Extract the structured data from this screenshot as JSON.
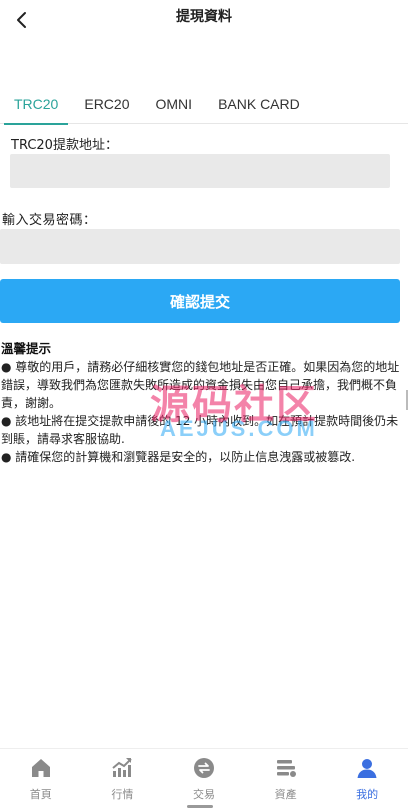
{
  "header": {
    "title": "提現資料",
    "back_icon": "chevron-left-icon"
  },
  "tabs": [
    {
      "label": "TRC20",
      "active": true
    },
    {
      "label": "ERC20",
      "active": false
    },
    {
      "label": "OMNI",
      "active": false
    },
    {
      "label": "BANK CARD",
      "active": false
    }
  ],
  "form": {
    "address_label": "TRC20提款地址：",
    "address_value": "",
    "password_label": "輸入交易密碼：",
    "password_value": "",
    "confirm_label": "確認提交"
  },
  "tips": {
    "title": "溫馨提示",
    "items": [
      "● 尊敬的用戶，請務必仔細核實您的錢包地址是否正確。如果因為您的地址錯誤，導致我們為您匯款失敗所造成的資金損失由您自己承擔，我們概不負責，謝謝。",
      "● 該地址將在提交提款申請後的 12 小時內收到。如在預計提款時間後仍未到賬，請尋求客服協助.",
      "● 請確保您的計算機和瀏覽器是安全的，以防止信息洩露或被篡改."
    ]
  },
  "watermark": {
    "main": "源码社区",
    "sub": "AEJUS.COM"
  },
  "nav": [
    {
      "label": "首頁",
      "icon": "home-icon",
      "active": false
    },
    {
      "label": "行情",
      "icon": "chart-icon",
      "active": false
    },
    {
      "label": "交易",
      "icon": "exchange-icon",
      "active": false
    },
    {
      "label": "資產",
      "icon": "wallet-icon",
      "active": false
    },
    {
      "label": "我的",
      "icon": "user-icon",
      "active": true
    }
  ],
  "colors": {
    "accent_tab": "#2aa39a",
    "primary_button": "#2ba8f4",
    "nav_active": "#3b6fe0",
    "nav_inactive": "#8a8a8a",
    "input_bg": "#e9e9e9"
  }
}
